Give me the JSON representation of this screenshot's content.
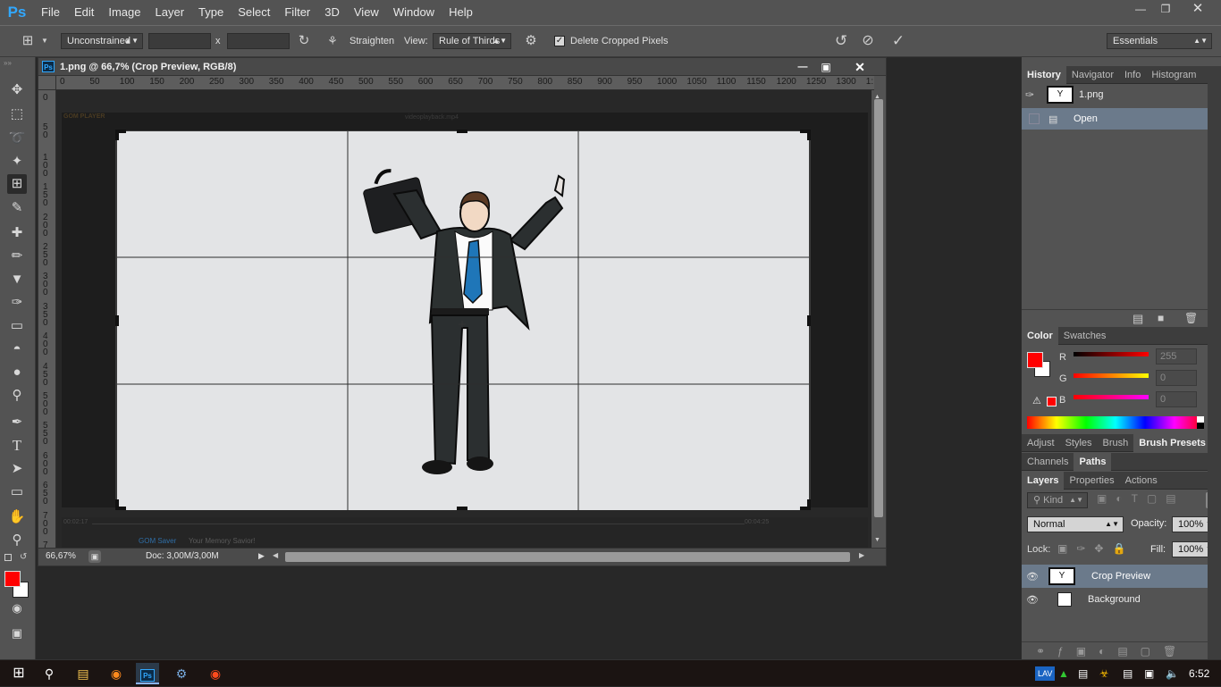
{
  "app": {
    "logo": "Ps"
  },
  "menu": [
    "File",
    "Edit",
    "Image",
    "Layer",
    "Type",
    "Select",
    "Filter",
    "3D",
    "View",
    "Window",
    "Help"
  ],
  "options": {
    "ratio": "Unconstrained",
    "x_sep": "x",
    "straighten": "Straighten",
    "view_label": "View:",
    "view_value": "Rule of Thirds",
    "delete_cropped": "Delete Cropped Pixels",
    "delete_cropped_checked": true,
    "workspace": "Essentials"
  },
  "document": {
    "title": "1.png @ 66,7% (Crop Preview, RGB/8)",
    "zoom": "66,67%",
    "doc_size": "Doc: 3,00M/3,00M"
  },
  "ruler": {
    "h_ticks": [
      "0",
      "50",
      "100",
      "150",
      "200",
      "250",
      "300",
      "350",
      "400",
      "450",
      "500",
      "550",
      "600",
      "650",
      "700",
      "750",
      "800",
      "850",
      "900",
      "950",
      "1000",
      "1050",
      "1100",
      "1150",
      "1200",
      "1250",
      "1300",
      "1:"
    ],
    "v_ticks": [
      "0",
      "50",
      "100",
      "150",
      "200",
      "250",
      "300",
      "350",
      "400",
      "450",
      "500",
      "550",
      "600",
      "650",
      "700",
      "750"
    ]
  },
  "video_player": {
    "app_name": "GOM PLAYER",
    "file": "videoplayback.mp4",
    "time_left": "00:02:17",
    "time_right": "00:04:25",
    "promo_brand": "GOM Saver",
    "promo_text": "Your Memory Savior!"
  },
  "history_panel": {
    "tabs": [
      "History",
      "Navigator",
      "Info",
      "Histogram"
    ],
    "snapshot": "1.png",
    "steps": [
      "Open"
    ]
  },
  "color_panel": {
    "tabs": [
      "Color",
      "Swatches"
    ],
    "foreground": "#ff0000",
    "background": "#ffffff",
    "r_label": "R",
    "g_label": "G",
    "b_label": "B",
    "r": "255",
    "g": "0",
    "b": "0"
  },
  "adjust_panel": {
    "tabs": [
      "Adjust",
      "Styles",
      "Brush",
      "Brush Presets"
    ]
  },
  "paths_panel": {
    "tabs": [
      "Channels",
      "Paths"
    ]
  },
  "layers_panel": {
    "tabs": [
      "Layers",
      "Properties",
      "Actions"
    ],
    "kind": "Kind",
    "blend": "Normal",
    "opacity_label": "Opacity:",
    "opacity": "100%",
    "lock_label": "Lock:",
    "fill_label": "Fill:",
    "fill": "100%",
    "layers": [
      {
        "name": "Crop Preview",
        "selected": true
      },
      {
        "name": "Background",
        "selected": false
      }
    ]
  },
  "taskbar": {
    "lang": "LAV",
    "time": "6:52"
  },
  "colors": {
    "accent": "#31a8ff",
    "panel": "#535353",
    "dark": "#282828"
  }
}
